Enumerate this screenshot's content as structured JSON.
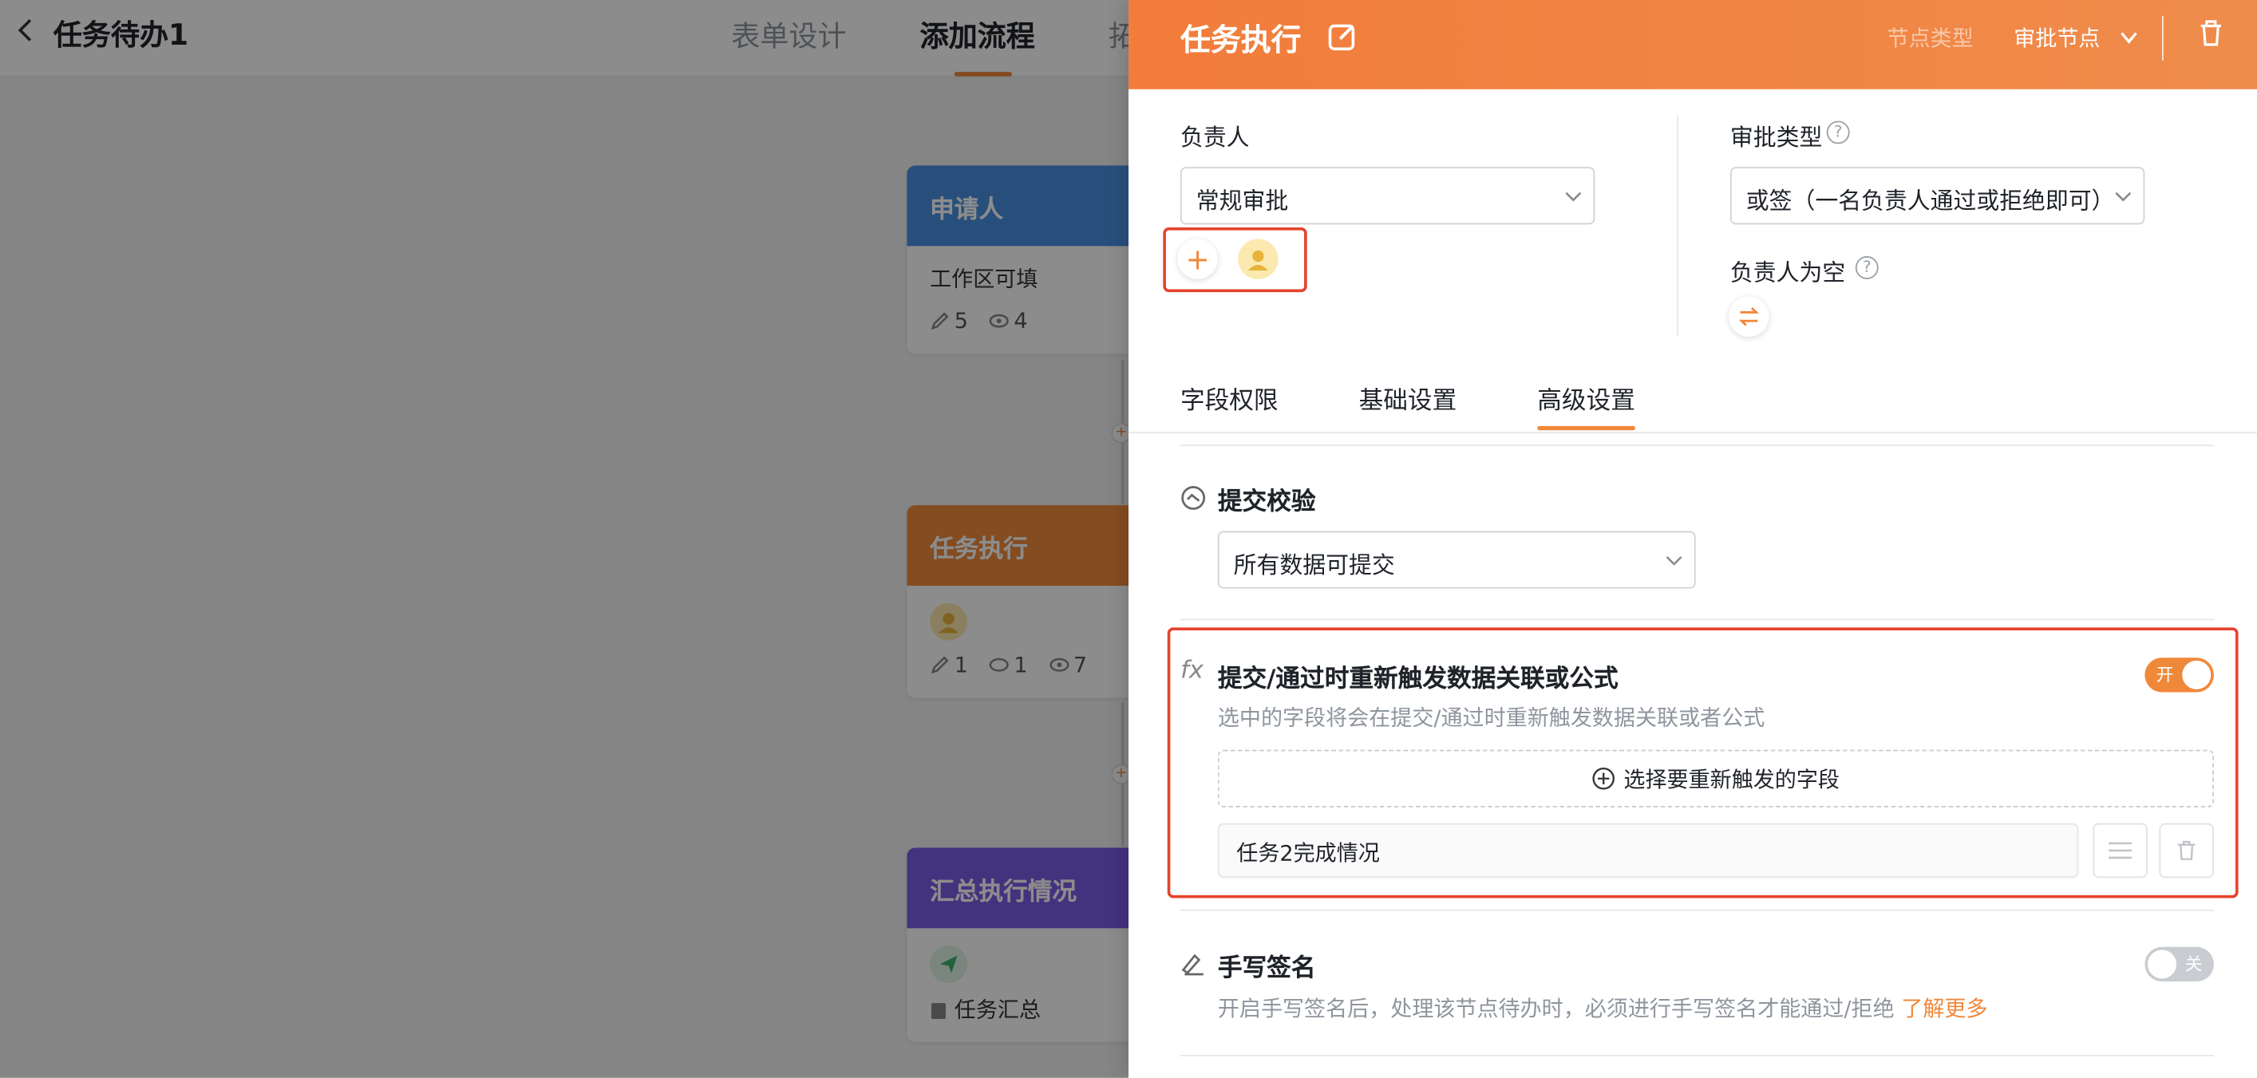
{
  "app": {
    "title": "任务待办1",
    "tabs": [
      "表单设计",
      "添加流程",
      "拓"
    ]
  },
  "flow": {
    "nodes": [
      {
        "title": "申请人",
        "color": "#4a90e2",
        "body": "工作区可填",
        "stats": [
          "5",
          "4"
        ]
      },
      {
        "title": "任务执行",
        "color": "#f08a3c",
        "stats": [
          "1",
          "1",
          "7"
        ]
      },
      {
        "title": "汇总执行情况",
        "color": "#7b5ce6",
        "body": "任务汇总"
      }
    ]
  },
  "drawer": {
    "title": "任务执行",
    "node_type_label": "节点类型",
    "node_type_value": "审批节点",
    "owner_label": "负责人",
    "owner_select": "常规审批",
    "approval_type_label": "审批类型",
    "approval_type_select": "或签（一名负责人通过或拒绝即可）",
    "owner_empty_label": "负责人为空",
    "tabs": [
      "字段权限",
      "基础设置",
      "高级设置"
    ],
    "active_tab": "高级设置",
    "submit_check": {
      "title": "提交校验",
      "select": "所有数据可提交"
    },
    "retrigger": {
      "title": "提交/通过时重新触发数据关联或公式",
      "desc": "选中的字段将会在提交/通过时重新触发数据关联或者公式",
      "toggle_label": "开",
      "toggle_on": true,
      "add_button": "选择要重新触发的字段",
      "fields": [
        "任务2完成情况"
      ]
    },
    "signature": {
      "title": "手写签名",
      "desc": "开启手写签名后，处理该节点待办时，必须进行手写签名才能通过/拒绝",
      "link": "了解更多",
      "toggle_label": "关",
      "toggle_on": false
    }
  },
  "colors": {
    "accent": "#f0883a",
    "highlight": "#e5432e"
  }
}
